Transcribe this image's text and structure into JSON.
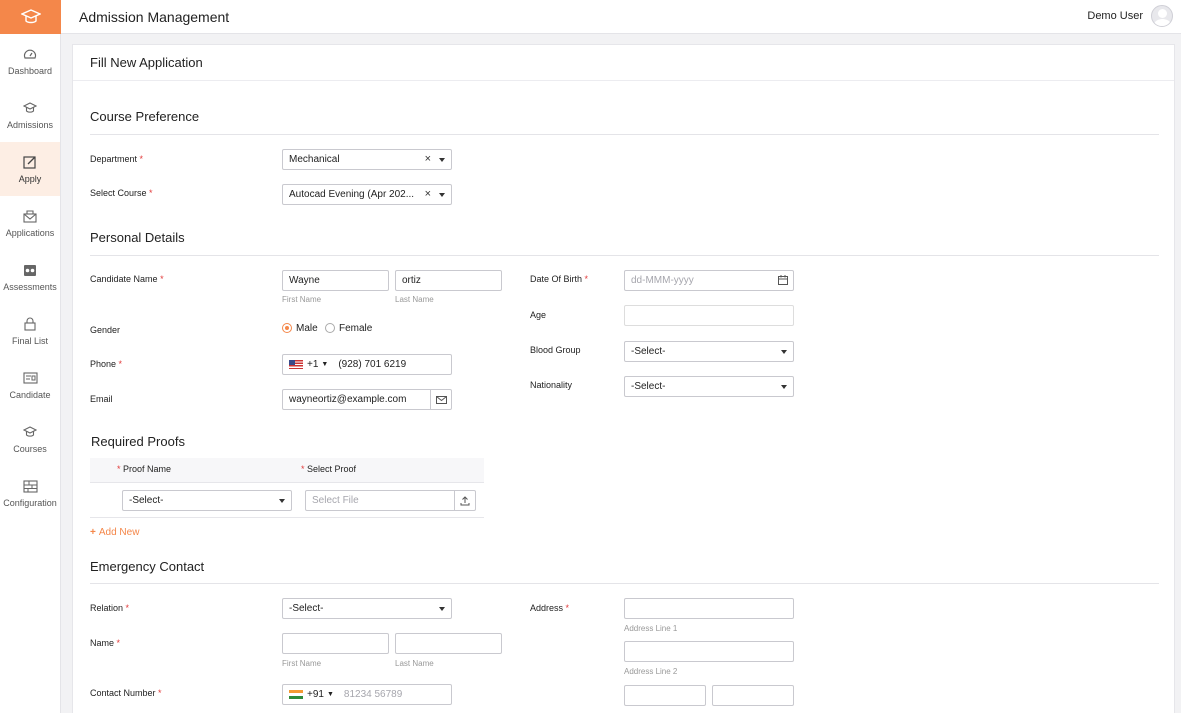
{
  "app": {
    "title": "Admission Management",
    "user": "Demo User",
    "accent": "#f4874a"
  },
  "sidebar": {
    "items": [
      {
        "label": "Dashboard",
        "icon": "dashboard-icon"
      },
      {
        "label": "Admissions",
        "icon": "graduation-cap-icon"
      },
      {
        "label": "Apply",
        "icon": "edit-icon",
        "active": true
      },
      {
        "label": "Applications",
        "icon": "inbox-icon"
      },
      {
        "label": "Assessments",
        "icon": "assessment-icon"
      },
      {
        "label": "Final List",
        "icon": "lock-icon"
      },
      {
        "label": "Candidate",
        "icon": "id-card-icon"
      },
      {
        "label": "Courses",
        "icon": "graduation-cap-icon"
      },
      {
        "label": "Configuration",
        "icon": "configuration-icon"
      }
    ]
  },
  "page": {
    "title": "Fill New Application"
  },
  "course": {
    "section": "Course Preference",
    "department_label": "Department",
    "department_value": "Mechanical",
    "course_label": "Select Course",
    "course_value": "Autocad Evening (Apr 202..."
  },
  "personal": {
    "section": "Personal Details",
    "name_label": "Candidate Name",
    "first_name": "Wayne",
    "last_name": "ortiz",
    "first_sub": "First Name",
    "last_sub": "Last Name",
    "gender_label": "Gender",
    "male": "Male",
    "female": "Female",
    "phone_label": "Phone",
    "phone_code": "+1",
    "phone_value": "(928) 701 6219",
    "email_label": "Email",
    "email_value": "wayneortiz@example.com",
    "dob_label": "Date Of Birth",
    "dob_placeholder": "dd-MMM-yyyy",
    "age_label": "Age",
    "blood_label": "Blood Group",
    "blood_value": "-Select-",
    "nation_label": "Nationality",
    "nation_value": "-Select-"
  },
  "proofs": {
    "section": "Required Proofs",
    "col_name": "Proof Name",
    "col_select": "Select Proof",
    "proof_value": "-Select-",
    "file_placeholder": "Select File",
    "add_new": "Add New"
  },
  "emergency": {
    "section": "Emergency Contact",
    "relation_label": "Relation",
    "relation_value": "-Select-",
    "name_label": "Name",
    "first_sub": "First Name",
    "last_sub": "Last Name",
    "contact_label": "Contact Number",
    "contact_code": "+91",
    "contact_placeholder": "81234 56789",
    "address_label": "Address",
    "addr1_sub": "Address Line 1",
    "addr2_sub": "Address Line 2"
  },
  "required_mark": "*"
}
